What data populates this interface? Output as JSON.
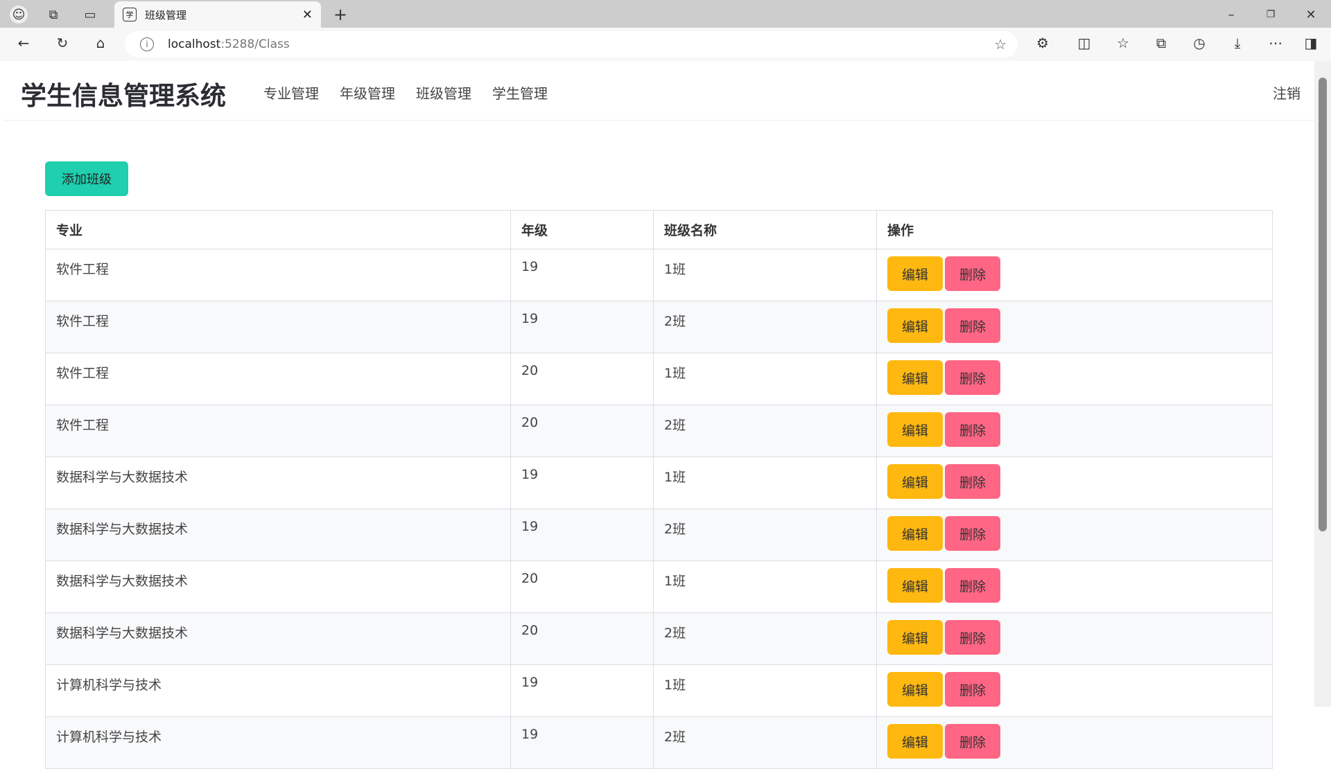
{
  "browser": {
    "tab_title": "班级管理",
    "url_host": "localhost",
    "url_rest": ":5288/Class"
  },
  "navbar": {
    "brand": "学生信息管理系统",
    "links": [
      "专业管理",
      "年级管理",
      "班级管理",
      "学生管理"
    ],
    "logout": "注销"
  },
  "main": {
    "add_label": "添加班级",
    "columns": [
      "专业",
      "年级",
      "班级名称",
      "操作"
    ],
    "edit_label": "编辑",
    "delete_label": "删除",
    "rows": [
      [
        "软件工程",
        "19",
        "1班"
      ],
      [
        "软件工程",
        "19",
        "2班"
      ],
      [
        "软件工程",
        "20",
        "1班"
      ],
      [
        "软件工程",
        "20",
        "2班"
      ],
      [
        "数据科学与大数据技术",
        "19",
        "1班"
      ],
      [
        "数据科学与大数据技术",
        "19",
        "2班"
      ],
      [
        "数据科学与大数据技术",
        "20",
        "1班"
      ],
      [
        "数据科学与大数据技术",
        "20",
        "2班"
      ],
      [
        "计算机科学与技术",
        "19",
        "1班"
      ],
      [
        "计算机科学与技术",
        "19",
        "2班"
      ]
    ]
  }
}
